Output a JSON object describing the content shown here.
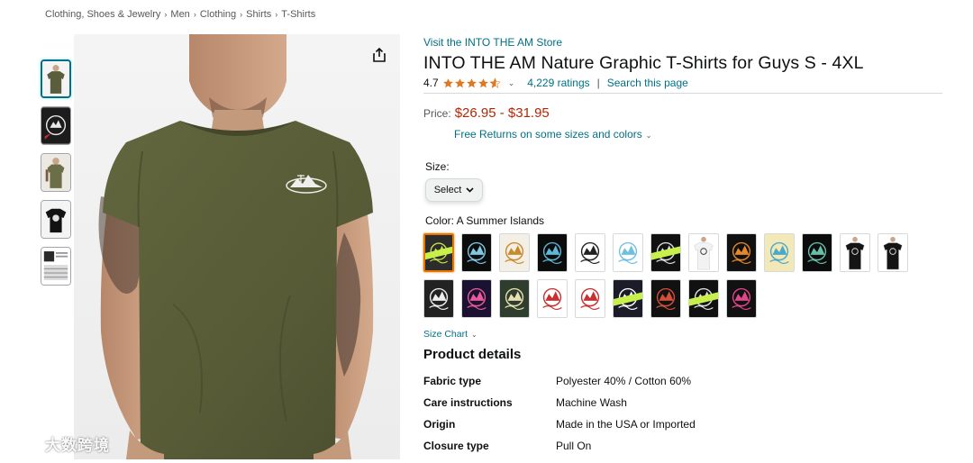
{
  "breadcrumb": [
    "Clothing, Shoes & Jewelry",
    "Men",
    "Clothing",
    "Shirts",
    "T-Shirts"
  ],
  "thumbnails": [
    {
      "name": "olive-tee-front",
      "active": true
    },
    {
      "name": "design-closeup",
      "active": false
    },
    {
      "name": "model-side-view",
      "active": false
    },
    {
      "name": "black-tee-flat",
      "active": false
    },
    {
      "name": "size-chart",
      "active": false
    }
  ],
  "product": {
    "store_link": "Visit the INTO THE AM Store",
    "title": "INTO THE AM Nature Graphic T-Shirts for Guys S - 4XL",
    "rating": "4.7",
    "ratings_count": "4,229 ratings",
    "search_page": "Search this page",
    "price_label": "Price:",
    "price_value": "$26.95 - $31.95",
    "returns": "Free Returns on some sizes and colors",
    "size_label": "Size:",
    "size_select": "Select",
    "color_label": "Color: A Summer Islands",
    "size_chart": "Size Chart",
    "details_title": "Product details"
  },
  "swatches": [
    {
      "bg": "#2c2c2c",
      "fg": "#c8e34a",
      "badge": true,
      "selected": true
    },
    {
      "bg": "#0c0c0c",
      "fg": "#7ec8e3",
      "badge": false
    },
    {
      "bg": "#f4efe6",
      "fg": "#c98a2a",
      "badge": false
    },
    {
      "bg": "#0c0c0c",
      "fg": "#5cb8d6",
      "badge": false
    },
    {
      "bg": "#ffffff",
      "fg": "#222222",
      "badge": false
    },
    {
      "bg": "#ffffff",
      "fg": "#6fc0e0",
      "badge": false
    },
    {
      "bg": "#111111",
      "fg": "#dddddd",
      "badge": true
    },
    {
      "bg": "#ffffff",
      "fg": "#333333",
      "badge": false,
      "tee": "white"
    },
    {
      "bg": "#111111",
      "fg": "#e4882a",
      "badge": false
    },
    {
      "bg": "#f3e8b8",
      "fg": "#4aa8c8",
      "badge": false
    },
    {
      "bg": "#0c0c0c",
      "fg": "#66c0a8",
      "badge": false
    },
    {
      "bg": "#ffffff",
      "fg": "#222222",
      "badge": false,
      "tee": "black"
    },
    {
      "bg": "#ffffff",
      "fg": "#222222",
      "badge": false,
      "tee": "black"
    },
    {
      "bg": "#222222",
      "fg": "#eeeeee",
      "badge": false
    },
    {
      "bg": "#1a1230",
      "fg": "#e85a9a",
      "badge": false
    },
    {
      "bg": "#2f3d2e",
      "fg": "#e8e0b0",
      "badge": false
    },
    {
      "bg": "#ffffff",
      "fg": "#c83030",
      "badge": false
    },
    {
      "bg": "#ffffff",
      "fg": "#c83030",
      "badge": false
    },
    {
      "bg": "#1b1b2a",
      "fg": "#ffffff",
      "badge": true
    },
    {
      "bg": "#111111",
      "fg": "#d0503a",
      "badge": false
    },
    {
      "bg": "#111111",
      "fg": "#e0e0e0",
      "badge": true
    },
    {
      "bg": "#111111",
      "fg": "#e0468a",
      "badge": false
    }
  ],
  "details": [
    {
      "key": "Fabric type",
      "value": "Polyester 40% / Cotton 60%"
    },
    {
      "key": "Care instructions",
      "value": "Machine Wash"
    },
    {
      "key": "Origin",
      "value": "Made in the USA or Imported"
    },
    {
      "key": "Closure type",
      "value": "Pull On"
    }
  ],
  "watermark": "大数跨境",
  "colors": {
    "link": "#007185",
    "price": "#b12704",
    "star": "#de7921",
    "selected_border": "#e77600",
    "shirt": "#5a5e3c"
  }
}
